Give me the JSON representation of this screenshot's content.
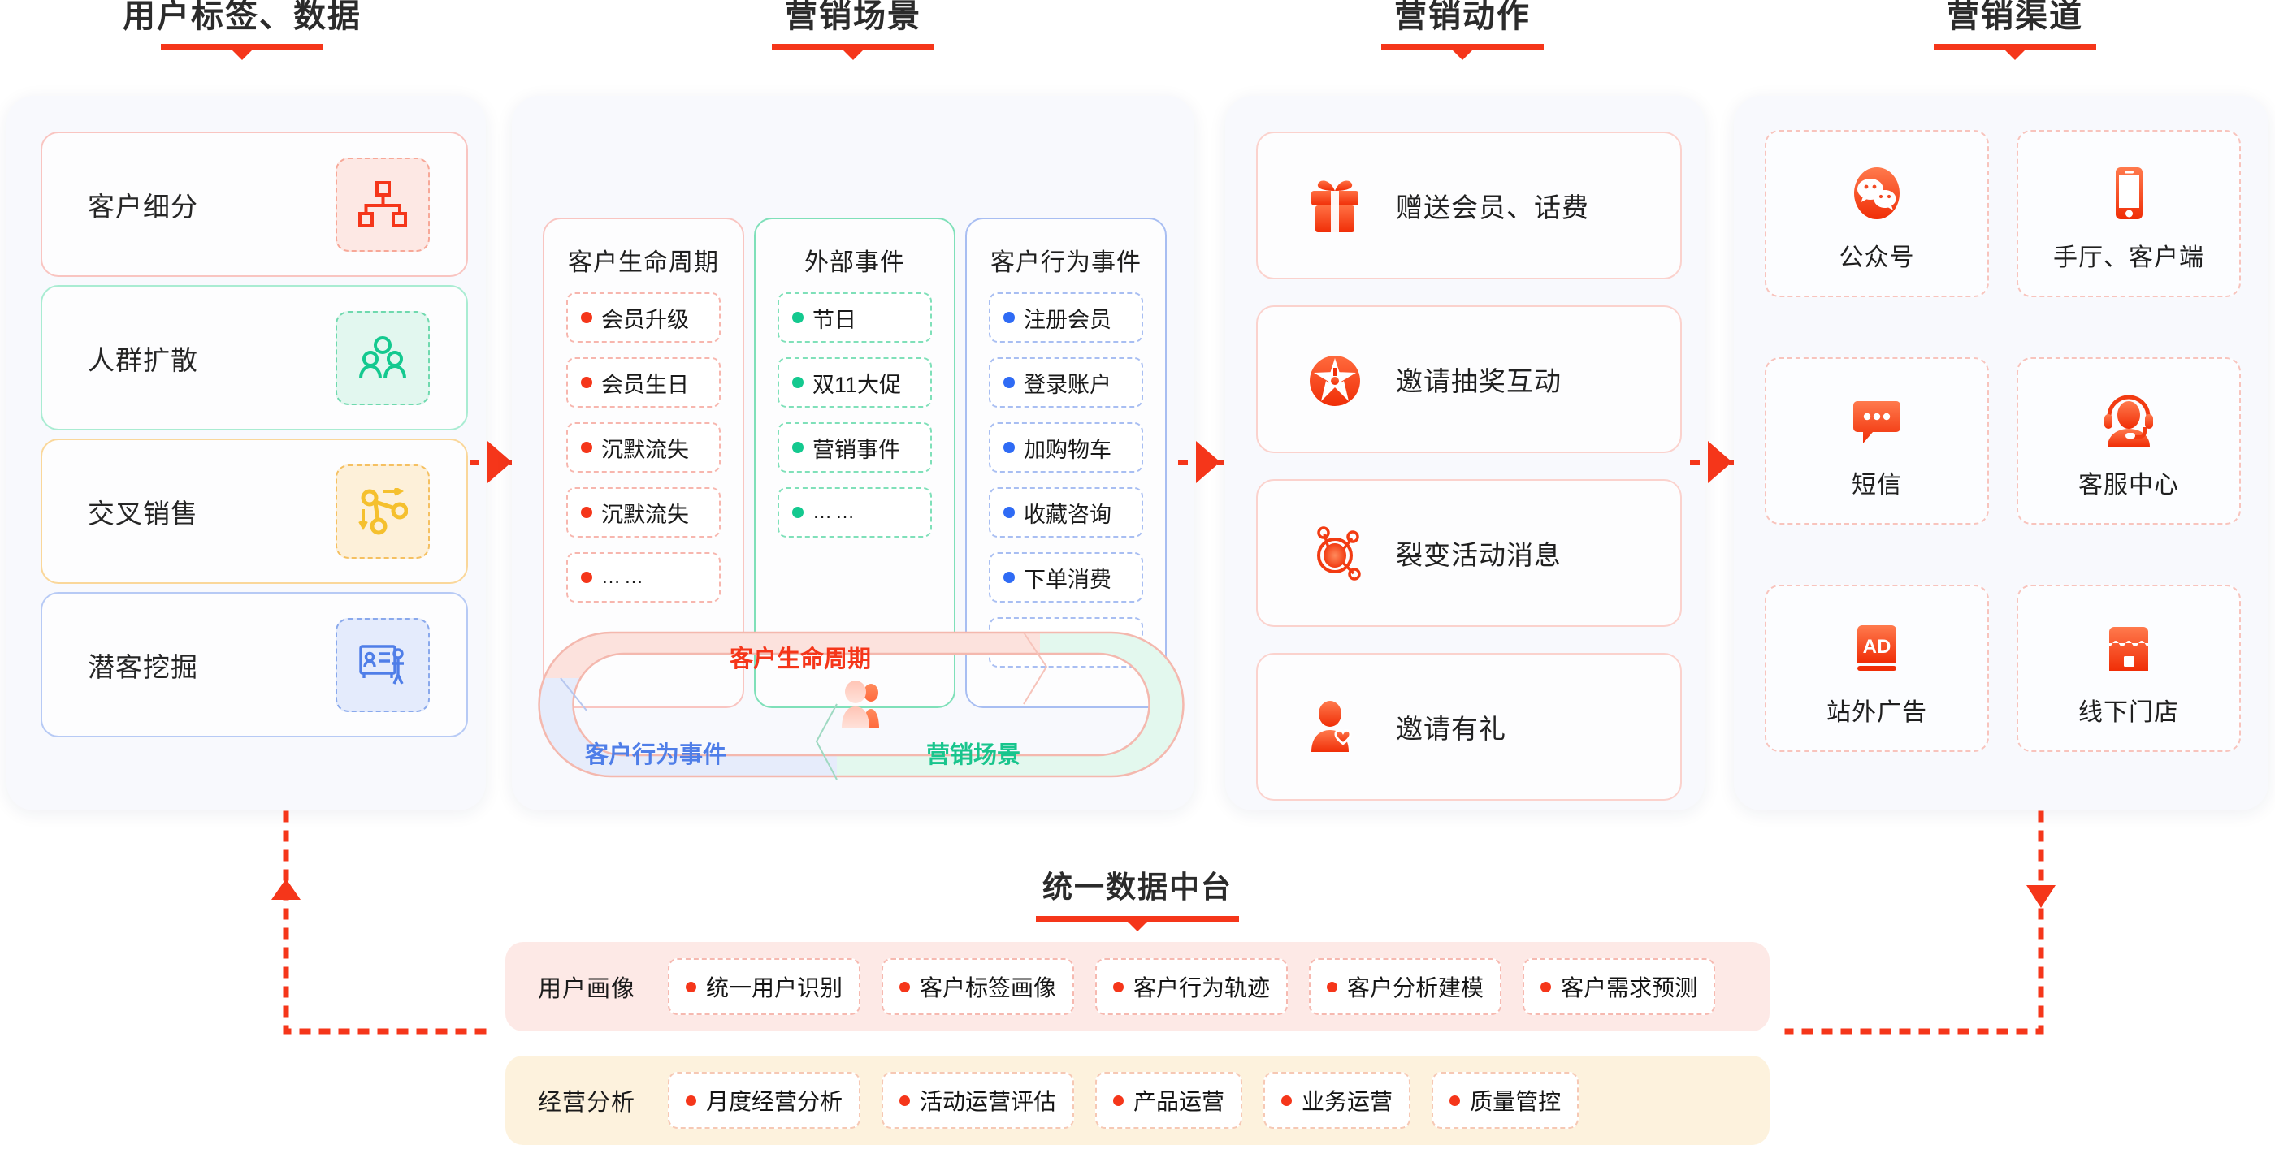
{
  "columns": [
    {
      "title": "用户标签、数据"
    },
    {
      "title": "营销场景"
    },
    {
      "title": "营销动作"
    },
    {
      "title": "营销渠道"
    }
  ],
  "user_tags": {
    "cards": [
      {
        "label": "客户细分",
        "color": "#f5361a",
        "icon": "org-chart-icon"
      },
      {
        "label": "人群扩散",
        "color": "#14c98f",
        "icon": "group-people-icon"
      },
      {
        "label": "交叉销售",
        "color": "#f5c02e",
        "icon": "cross-sell-nodes-icon"
      },
      {
        "label": "潜客挖掘",
        "color": "#4f7ee8",
        "icon": "presentation-person-icon"
      }
    ]
  },
  "scenarios": {
    "panels": [
      {
        "title": "客户生命周期",
        "accent": "#f5361a",
        "items": [
          "会员升级",
          "会员生日",
          "沉默流失",
          "沉默流失",
          "……"
        ]
      },
      {
        "title": "外部事件",
        "accent": "#14c98f",
        "items": [
          "节日",
          "双11大促",
          "营销事件",
          "……"
        ]
      },
      {
        "title": "客户行为事件",
        "accent": "#2f6bf5",
        "items": [
          "注册会员",
          "登录账户",
          "加购物车",
          "收藏咨询",
          "下单消费",
          "……"
        ]
      }
    ],
    "cycle": {
      "top_label": "客户生命周期",
      "bottom_left_label": "客户行为事件",
      "bottom_right_label": "营销场景",
      "top_color": "#f5361a",
      "bottom_left_color": "#4f7ee8",
      "bottom_right_color": "#19c58d",
      "center_icon": "customer-avatar-icon"
    }
  },
  "actions": {
    "cards": [
      {
        "label": "赠送会员、话费",
        "icon": "gift-icon"
      },
      {
        "label": "邀请抽奖互动",
        "icon": "lottery-wheel-icon"
      },
      {
        "label": "裂变活动消息",
        "icon": "fission-network-icon"
      },
      {
        "label": "邀请有礼",
        "icon": "invite-heart-icon"
      }
    ]
  },
  "channels": {
    "tiles": [
      {
        "label": "公众号",
        "icon": "wechat-icon"
      },
      {
        "label": "手厅、客户端",
        "icon": "mobile-phone-icon"
      },
      {
        "label": "短信",
        "icon": "sms-bubble-icon"
      },
      {
        "label": "客服中心",
        "icon": "headset-agent-icon"
      },
      {
        "label": "站外广告",
        "icon": "ad-banner-icon"
      },
      {
        "label": "线下门店",
        "icon": "storefront-icon"
      }
    ]
  },
  "data_platform": {
    "title": "统一数据中台",
    "rows": [
      {
        "label": "用户画像",
        "theme": "pink",
        "items": [
          "统一用户识别",
          "客户标签画像",
          "客户行为轨迹",
          "客户分析建模",
          "客户需求预测"
        ]
      },
      {
        "label": "经营分析",
        "theme": "cream",
        "items": [
          "月度经营分析",
          "活动运营评估",
          "产品运营",
          "业务运营",
          "质量管控"
        ]
      }
    ]
  },
  "theme": {
    "accent": "#f5361a",
    "panel_bg": "#f8f9fd",
    "page_bg": "#ffffff"
  }
}
